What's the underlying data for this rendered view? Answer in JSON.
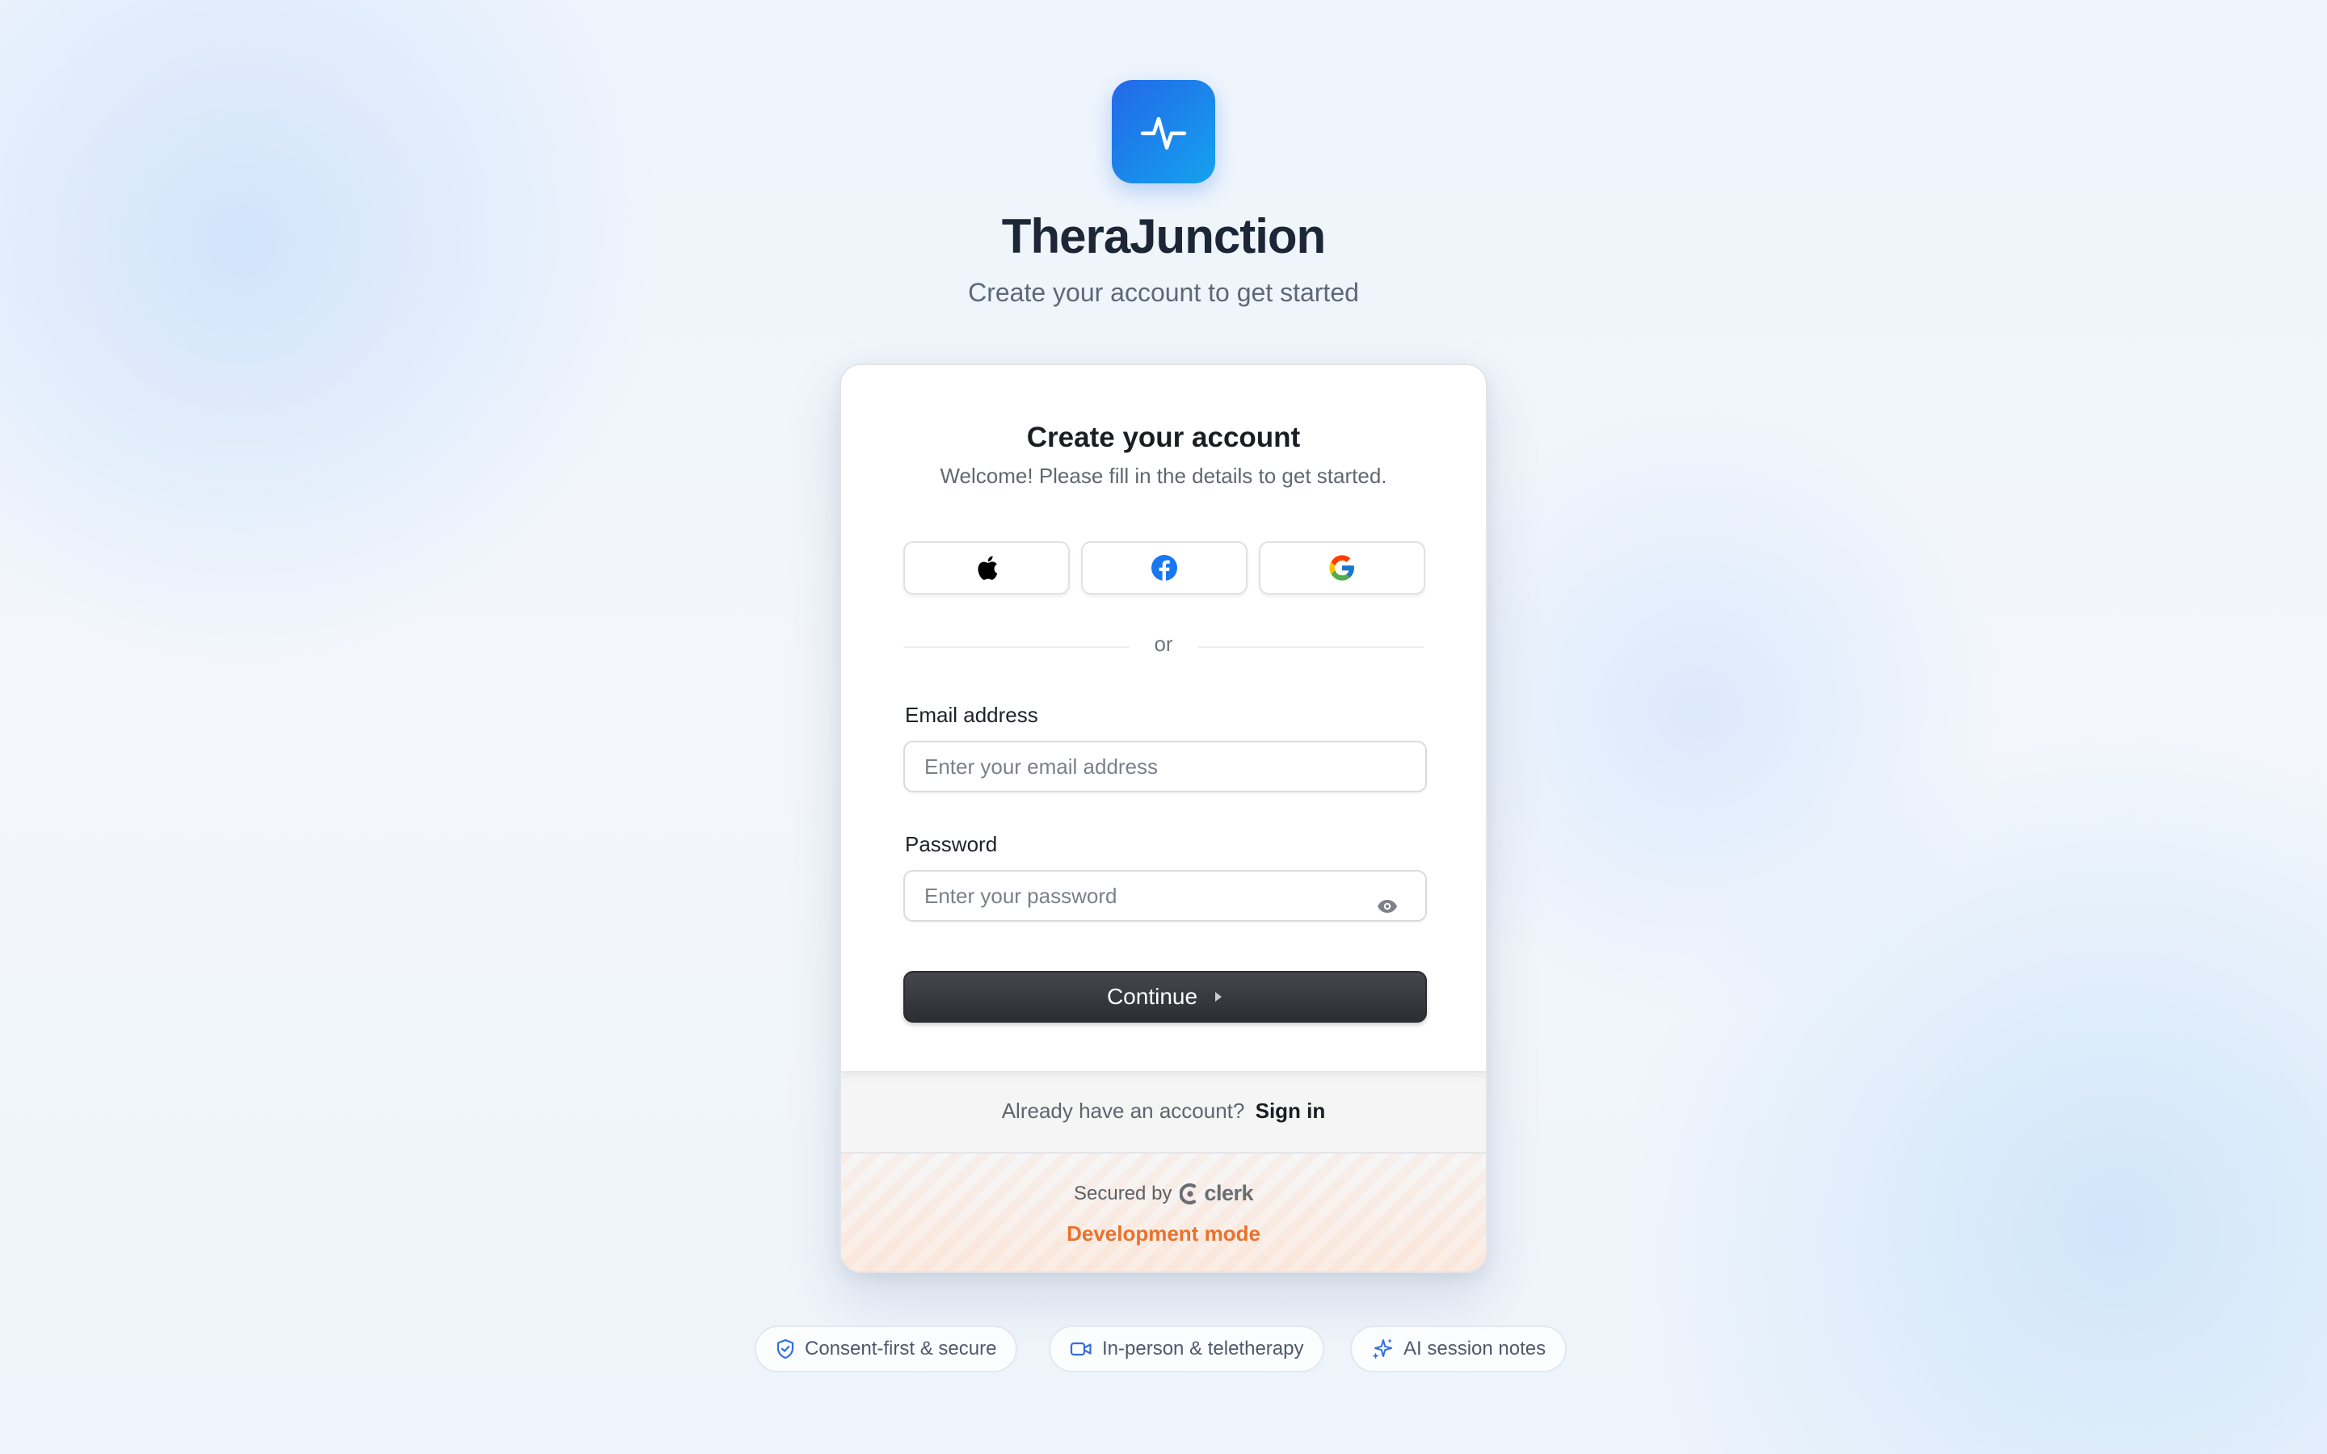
{
  "brand": {
    "name": "TheraJunction",
    "tagline": "Create your account to get started",
    "logo_icon": "activity-pulse-icon",
    "accent_gradient": [
      "#2368e8",
      "#14a2ee"
    ]
  },
  "card": {
    "title": "Create your account",
    "subtitle": "Welcome! Please fill in the details to get started.",
    "social": [
      {
        "provider": "Apple",
        "icon": "apple-icon"
      },
      {
        "provider": "Facebook",
        "icon": "facebook-icon",
        "color": "#1877f2"
      },
      {
        "provider": "Google",
        "icon": "google-icon"
      }
    ],
    "divider_text": "or",
    "email": {
      "label": "Email address",
      "placeholder": "Enter your email address",
      "value": ""
    },
    "password": {
      "label": "Password",
      "placeholder": "Enter your password",
      "value": ""
    },
    "continue_label": "Continue",
    "signin_prompt": "Already have an account?",
    "signin_link": "Sign in",
    "secured_by": "Secured by",
    "secured_brand": "clerk",
    "dev_mode": "Development mode",
    "dev_mode_color": "#e8722e"
  },
  "features": [
    {
      "label": "Consent-first & secure",
      "icon": "shield-check-icon"
    },
    {
      "label": "In-person & teletherapy",
      "icon": "video-camera-icon"
    },
    {
      "label": "AI session notes",
      "icon": "sparkles-icon"
    }
  ]
}
